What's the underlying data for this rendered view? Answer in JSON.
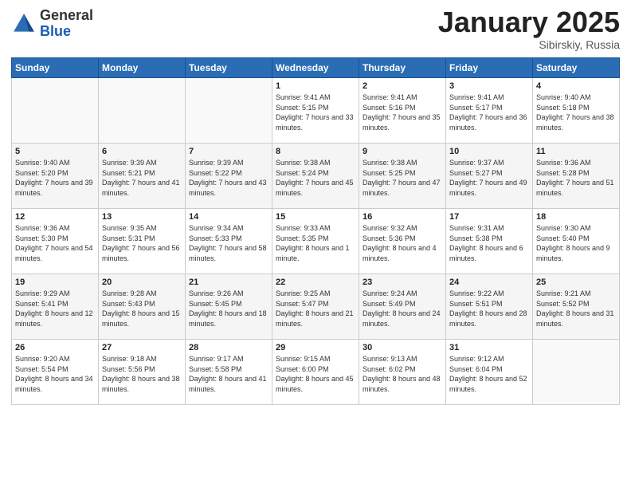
{
  "logo": {
    "general": "General",
    "blue": "Blue"
  },
  "header": {
    "month": "January 2025",
    "location": "Sibirskiy, Russia"
  },
  "weekdays": [
    "Sunday",
    "Monday",
    "Tuesday",
    "Wednesday",
    "Thursday",
    "Friday",
    "Saturday"
  ],
  "weeks": [
    [
      {
        "day": "",
        "sunrise": "",
        "sunset": "",
        "daylight": ""
      },
      {
        "day": "",
        "sunrise": "",
        "sunset": "",
        "daylight": ""
      },
      {
        "day": "",
        "sunrise": "",
        "sunset": "",
        "daylight": ""
      },
      {
        "day": "1",
        "sunrise": "Sunrise: 9:41 AM",
        "sunset": "Sunset: 5:15 PM",
        "daylight": "Daylight: 7 hours and 33 minutes."
      },
      {
        "day": "2",
        "sunrise": "Sunrise: 9:41 AM",
        "sunset": "Sunset: 5:16 PM",
        "daylight": "Daylight: 7 hours and 35 minutes."
      },
      {
        "day": "3",
        "sunrise": "Sunrise: 9:41 AM",
        "sunset": "Sunset: 5:17 PM",
        "daylight": "Daylight: 7 hours and 36 minutes."
      },
      {
        "day": "4",
        "sunrise": "Sunrise: 9:40 AM",
        "sunset": "Sunset: 5:18 PM",
        "daylight": "Daylight: 7 hours and 38 minutes."
      }
    ],
    [
      {
        "day": "5",
        "sunrise": "Sunrise: 9:40 AM",
        "sunset": "Sunset: 5:20 PM",
        "daylight": "Daylight: 7 hours and 39 minutes."
      },
      {
        "day": "6",
        "sunrise": "Sunrise: 9:39 AM",
        "sunset": "Sunset: 5:21 PM",
        "daylight": "Daylight: 7 hours and 41 minutes."
      },
      {
        "day": "7",
        "sunrise": "Sunrise: 9:39 AM",
        "sunset": "Sunset: 5:22 PM",
        "daylight": "Daylight: 7 hours and 43 minutes."
      },
      {
        "day": "8",
        "sunrise": "Sunrise: 9:38 AM",
        "sunset": "Sunset: 5:24 PM",
        "daylight": "Daylight: 7 hours and 45 minutes."
      },
      {
        "day": "9",
        "sunrise": "Sunrise: 9:38 AM",
        "sunset": "Sunset: 5:25 PM",
        "daylight": "Daylight: 7 hours and 47 minutes."
      },
      {
        "day": "10",
        "sunrise": "Sunrise: 9:37 AM",
        "sunset": "Sunset: 5:27 PM",
        "daylight": "Daylight: 7 hours and 49 minutes."
      },
      {
        "day": "11",
        "sunrise": "Sunrise: 9:36 AM",
        "sunset": "Sunset: 5:28 PM",
        "daylight": "Daylight: 7 hours and 51 minutes."
      }
    ],
    [
      {
        "day": "12",
        "sunrise": "Sunrise: 9:36 AM",
        "sunset": "Sunset: 5:30 PM",
        "daylight": "Daylight: 7 hours and 54 minutes."
      },
      {
        "day": "13",
        "sunrise": "Sunrise: 9:35 AM",
        "sunset": "Sunset: 5:31 PM",
        "daylight": "Daylight: 7 hours and 56 minutes."
      },
      {
        "day": "14",
        "sunrise": "Sunrise: 9:34 AM",
        "sunset": "Sunset: 5:33 PM",
        "daylight": "Daylight: 7 hours and 58 minutes."
      },
      {
        "day": "15",
        "sunrise": "Sunrise: 9:33 AM",
        "sunset": "Sunset: 5:35 PM",
        "daylight": "Daylight: 8 hours and 1 minute."
      },
      {
        "day": "16",
        "sunrise": "Sunrise: 9:32 AM",
        "sunset": "Sunset: 5:36 PM",
        "daylight": "Daylight: 8 hours and 4 minutes."
      },
      {
        "day": "17",
        "sunrise": "Sunrise: 9:31 AM",
        "sunset": "Sunset: 5:38 PM",
        "daylight": "Daylight: 8 hours and 6 minutes."
      },
      {
        "day": "18",
        "sunrise": "Sunrise: 9:30 AM",
        "sunset": "Sunset: 5:40 PM",
        "daylight": "Daylight: 8 hours and 9 minutes."
      }
    ],
    [
      {
        "day": "19",
        "sunrise": "Sunrise: 9:29 AM",
        "sunset": "Sunset: 5:41 PM",
        "daylight": "Daylight: 8 hours and 12 minutes."
      },
      {
        "day": "20",
        "sunrise": "Sunrise: 9:28 AM",
        "sunset": "Sunset: 5:43 PM",
        "daylight": "Daylight: 8 hours and 15 minutes."
      },
      {
        "day": "21",
        "sunrise": "Sunrise: 9:26 AM",
        "sunset": "Sunset: 5:45 PM",
        "daylight": "Daylight: 8 hours and 18 minutes."
      },
      {
        "day": "22",
        "sunrise": "Sunrise: 9:25 AM",
        "sunset": "Sunset: 5:47 PM",
        "daylight": "Daylight: 8 hours and 21 minutes."
      },
      {
        "day": "23",
        "sunrise": "Sunrise: 9:24 AM",
        "sunset": "Sunset: 5:49 PM",
        "daylight": "Daylight: 8 hours and 24 minutes."
      },
      {
        "day": "24",
        "sunrise": "Sunrise: 9:22 AM",
        "sunset": "Sunset: 5:51 PM",
        "daylight": "Daylight: 8 hours and 28 minutes."
      },
      {
        "day": "25",
        "sunrise": "Sunrise: 9:21 AM",
        "sunset": "Sunset: 5:52 PM",
        "daylight": "Daylight: 8 hours and 31 minutes."
      }
    ],
    [
      {
        "day": "26",
        "sunrise": "Sunrise: 9:20 AM",
        "sunset": "Sunset: 5:54 PM",
        "daylight": "Daylight: 8 hours and 34 minutes."
      },
      {
        "day": "27",
        "sunrise": "Sunrise: 9:18 AM",
        "sunset": "Sunset: 5:56 PM",
        "daylight": "Daylight: 8 hours and 38 minutes."
      },
      {
        "day": "28",
        "sunrise": "Sunrise: 9:17 AM",
        "sunset": "Sunset: 5:58 PM",
        "daylight": "Daylight: 8 hours and 41 minutes."
      },
      {
        "day": "29",
        "sunrise": "Sunrise: 9:15 AM",
        "sunset": "Sunset: 6:00 PM",
        "daylight": "Daylight: 8 hours and 45 minutes."
      },
      {
        "day": "30",
        "sunrise": "Sunrise: 9:13 AM",
        "sunset": "Sunset: 6:02 PM",
        "daylight": "Daylight: 8 hours and 48 minutes."
      },
      {
        "day": "31",
        "sunrise": "Sunrise: 9:12 AM",
        "sunset": "Sunset: 6:04 PM",
        "daylight": "Daylight: 8 hours and 52 minutes."
      },
      {
        "day": "",
        "sunrise": "",
        "sunset": "",
        "daylight": ""
      }
    ]
  ]
}
